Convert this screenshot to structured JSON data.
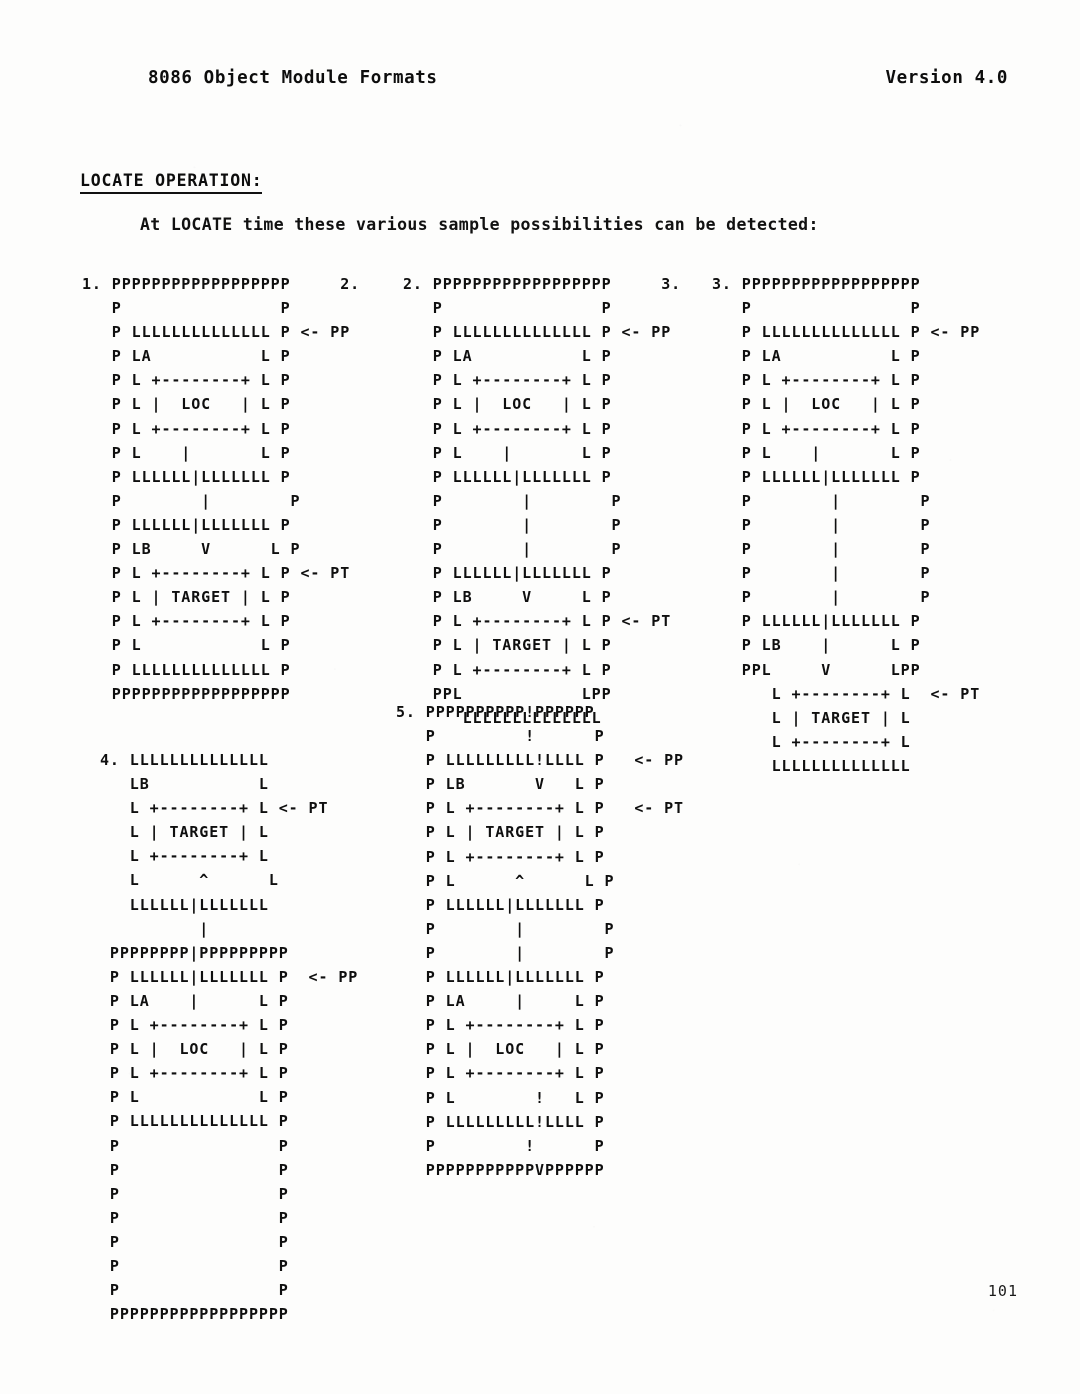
{
  "header": {
    "title": "8086 Object Module Formats",
    "version": "Version 4.0"
  },
  "section": {
    "heading": "LOCATE OPERATION:",
    "intro": "At LOCATE time these various sample possibilities can be detected:"
  },
  "figures": {
    "fig1": "1. PPPPPPPPPPPPPPPPPP     2.\n   P                P\n   P LLLLLLLLLLLLLL P <- PP\n   P LA           L P\n   P L +--------+ L P\n   P L |  LOC   | L P\n   P L +--------+ L P\n   P L    |       L P\n   P LLLLLL|LLLLLLL P\n   P        |        P\n   P LLLLLL|LLLLLLL P\n   P LB     V      L P\n   P L +--------+ L P <- PT\n   P L | TARGET | L P\n   P L +--------+ L P\n   P L            L P\n   P LLLLLLLLLLLLLL P\n   PPPPPPPPPPPPPPPPPP",
    "fig2": "2. PPPPPPPPPPPPPPPPPP     3.\n   P                P\n   P LLLLLLLLLLLLLL P <- PP\n   P LA           L P\n   P L +--------+ L P\n   P L |  LOC   | L P\n   P L +--------+ L P\n   P L    |       L P\n   P LLLLLL|LLLLLLL P\n   P        |        P\n   P        |        P\n   P        |        P\n   P LLLLLL|LLLLLLL P\n   P LB     V     L P\n   P L +--------+ L P <- PT\n   P L | TARGET | L P\n   P L +--------+ L P\n   PPL            LPP\n      LLLLLLLLLLLLLL",
    "fig3": "3. PPPPPPPPPPPPPPPPPP\n   P                P\n   P LLLLLLLLLLLLLL P <- PP\n   P LA           L P\n   P L +--------+ L P\n   P L |  LOC   | L P\n   P L +--------+ L P\n   P L    |       L P\n   P LLLLLL|LLLLLLL P\n   P        |        P\n   P        |        P\n   P        |        P\n   P        |        P\n   P        |        P\n   P LLLLLL|LLLLLLL P\n   P LB    |      L P\n   PPL     V      LPP\n      L +--------+ L  <- PT\n      L | TARGET | L\n      L +--------+ L\n      LLLLLLLLLLLLLL",
    "fig4": "4. LLLLLLLLLLLLLL\n   LB           L\n   L +--------+ L <- PT\n   L | TARGET | L\n   L +--------+ L\n   L      ^      L\n   LLLLLL|LLLLLLL\n          |\n PPPPPPPP|PPPPPPPPP\n P LLLLLL|LLLLLLL P  <- PP\n P LA    |      L P\n P L +--------+ L P\n P L |  LOC   | L P\n P L +--------+ L P\n P L            L P\n P LLLLLLLLLLLLLL P\n P                P\n P                P\n P                P\n P                P\n P                P\n P                P\n P                P\n PPPPPPPPPPPPPPPPPP",
    "fig5": "5. PPPPPPPPPP!PPPPPP\n   P         !      P\n   P LLLLLLLLL!LLLL P   <- PP\n   P LB       V   L P\n   P L +--------+ L P   <- PT\n   P L | TARGET | L P\n   P L +--------+ L P\n   P L      ^      L P\n   P LLLLLL|LLLLLLL P\n   P        |        P\n   P        |        P\n   P LLLLLL|LLLLLLL P\n   P LA     |     L P\n   P L +--------+ L P\n   P L |  LOC   | L P\n   P L +--------+ L P\n   P L        !   L P\n   P LLLLLLLLL!LLLL P\n   P         !      P\n   PPPPPPPPPPPVPPPPPP"
  },
  "folio": {
    "page_number": "101"
  }
}
